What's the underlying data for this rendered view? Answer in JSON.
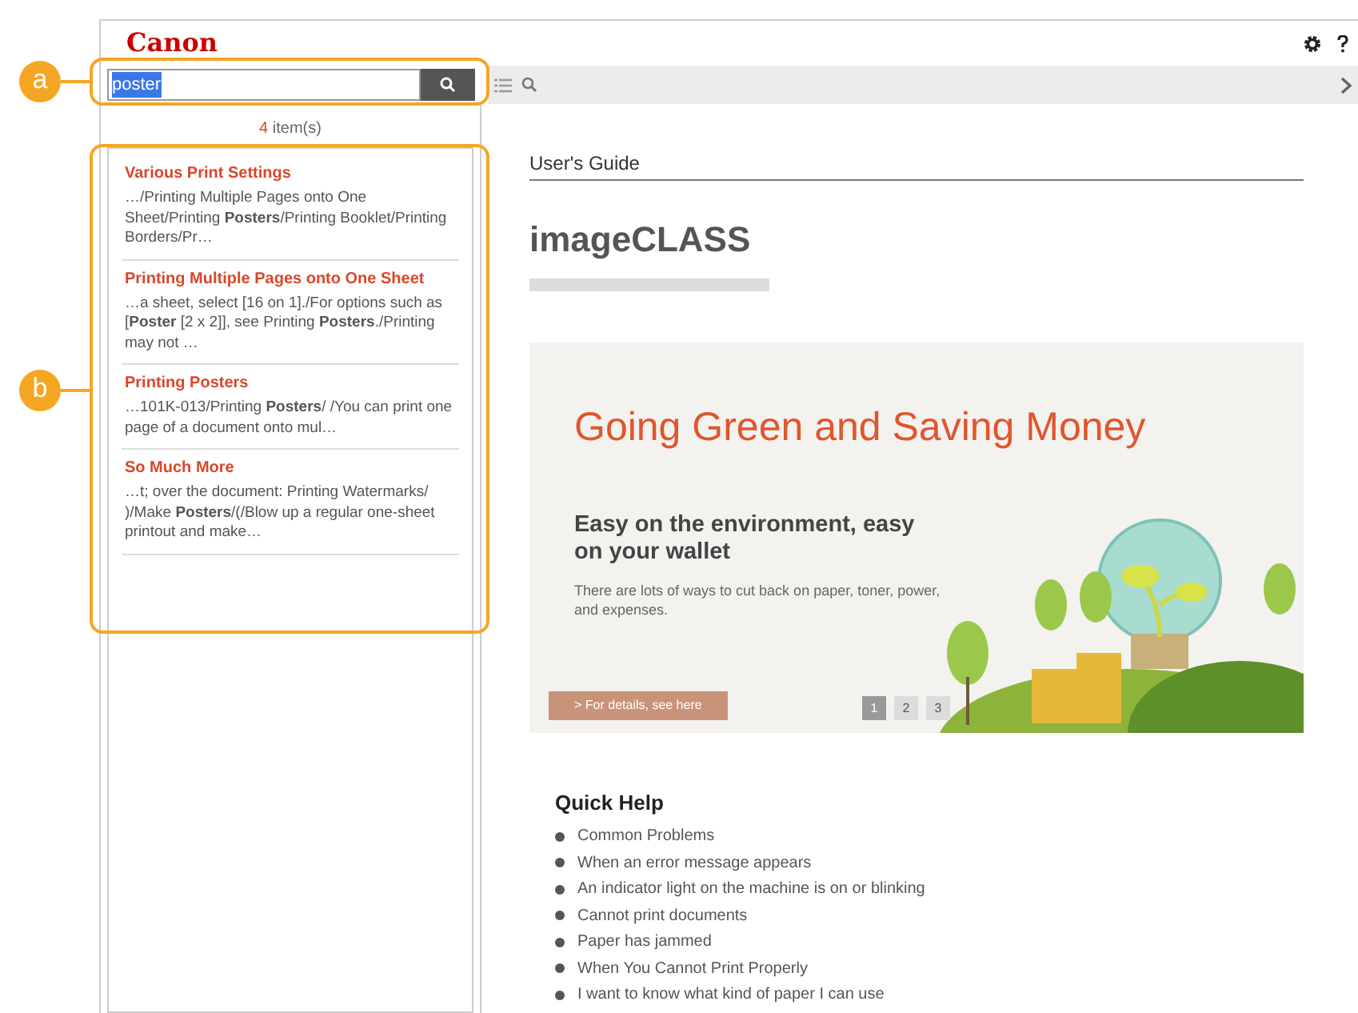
{
  "header": {
    "logo": "Canon"
  },
  "search": {
    "value": "poster",
    "callout": "a"
  },
  "results": {
    "count": "4",
    "count_label": "item(s)",
    "callout": "b",
    "items": [
      {
        "title": "Various Print Settings",
        "snippet": "…/Printing Multiple Pages onto One Sheet/Printing **Posters**/Printing Booklet/Printing Borders/Pr…"
      },
      {
        "title": "Printing Multiple Pages onto One Sheet",
        "snippet": "…a sheet, select [16 on 1]./For options such as [**Poster** [2 x 2]], see Printing **Posters**./Printing may not …"
      },
      {
        "title": "Printing Posters",
        "snippet": "…101K-013/Printing **Posters**/ /You can print one page of a document onto mul…"
      },
      {
        "title": "So Much More",
        "snippet": "…t; over the document: Printing Watermarks/ )/Make **Posters**/(/Blow up a regular one-sheet printout and make…"
      }
    ]
  },
  "content": {
    "guide_label": "User's Guide",
    "product": "imageCLASS",
    "banner": {
      "title": "Going Green and Saving Money",
      "subtitle": "Easy on the environment, easy on your wallet",
      "text": "There are lots of ways to cut back on paper, toner, power, and expenses.",
      "button": "> For details, see here",
      "pages": [
        {
          "label": "1",
          "selected": true
        },
        {
          "label": "2",
          "selected": false
        },
        {
          "label": "3",
          "selected": false
        }
      ]
    },
    "quick_help": {
      "title": "Quick Help",
      "items": [
        "Common Problems",
        "When an error message appears",
        "An indicator light on the machine is on or blinking",
        "Cannot print documents",
        "Paper has jammed",
        "When You Cannot Print Properly",
        "I want to know what kind of paper I can use"
      ]
    }
  }
}
